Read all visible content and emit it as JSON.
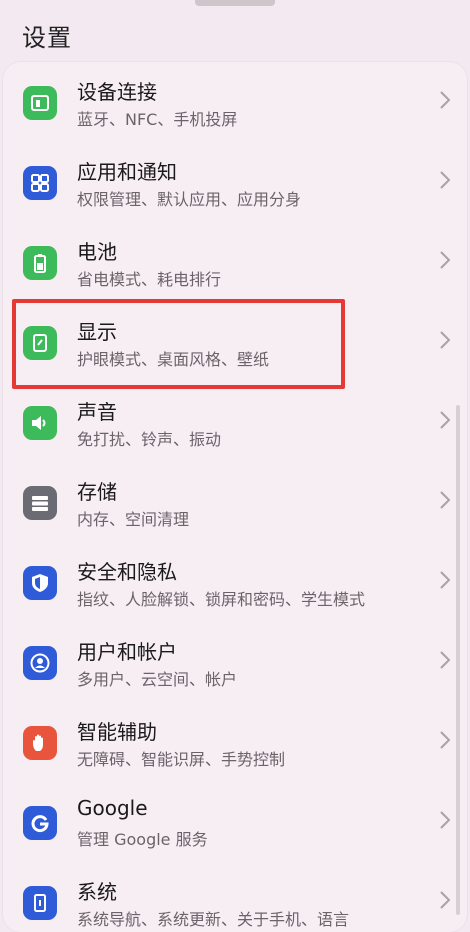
{
  "header": {
    "title": "设置"
  },
  "items": [
    {
      "label": "设备连接",
      "sub": "蓝牙、NFC、手机投屏",
      "icon": "device-connect-icon",
      "color": "#3dbb5a"
    },
    {
      "label": "应用和通知",
      "sub": "权限管理、默认应用、应用分身",
      "icon": "apps-grid-icon",
      "color": "#2f5bd8"
    },
    {
      "label": "电池",
      "sub": "省电模式、耗电排行",
      "icon": "battery-icon",
      "color": "#3dbb5a"
    },
    {
      "label": "显示",
      "sub": "护眼模式、桌面风格、壁纸",
      "icon": "display-icon",
      "color": "#3dbb5a"
    },
    {
      "label": "声音",
      "sub": "免打扰、铃声、振动",
      "icon": "speaker-icon",
      "color": "#3dbb5a"
    },
    {
      "label": "存储",
      "sub": "内存、空间清理",
      "icon": "storage-icon",
      "color": "#6b6b73"
    },
    {
      "label": "安全和隐私",
      "sub": "指纹、人脸解锁、锁屏和密码、学生模式",
      "icon": "shield-icon",
      "color": "#2f5bd8"
    },
    {
      "label": "用户和帐户",
      "sub": "多用户、云空间、帐户",
      "icon": "user-icon",
      "color": "#2f5bd8"
    },
    {
      "label": "智能辅助",
      "sub": "无障碍、智能识屏、手势控制",
      "icon": "hand-icon",
      "color": "#e8543c"
    },
    {
      "label": "Google",
      "sub": "管理 Google 服务",
      "icon": "google-icon",
      "color": "#2f5bd8"
    },
    {
      "label": "系统",
      "sub": "系统导航、系统更新、关于手机、语言",
      "icon": "system-phone-icon",
      "color": "#2f5bd8"
    }
  ]
}
